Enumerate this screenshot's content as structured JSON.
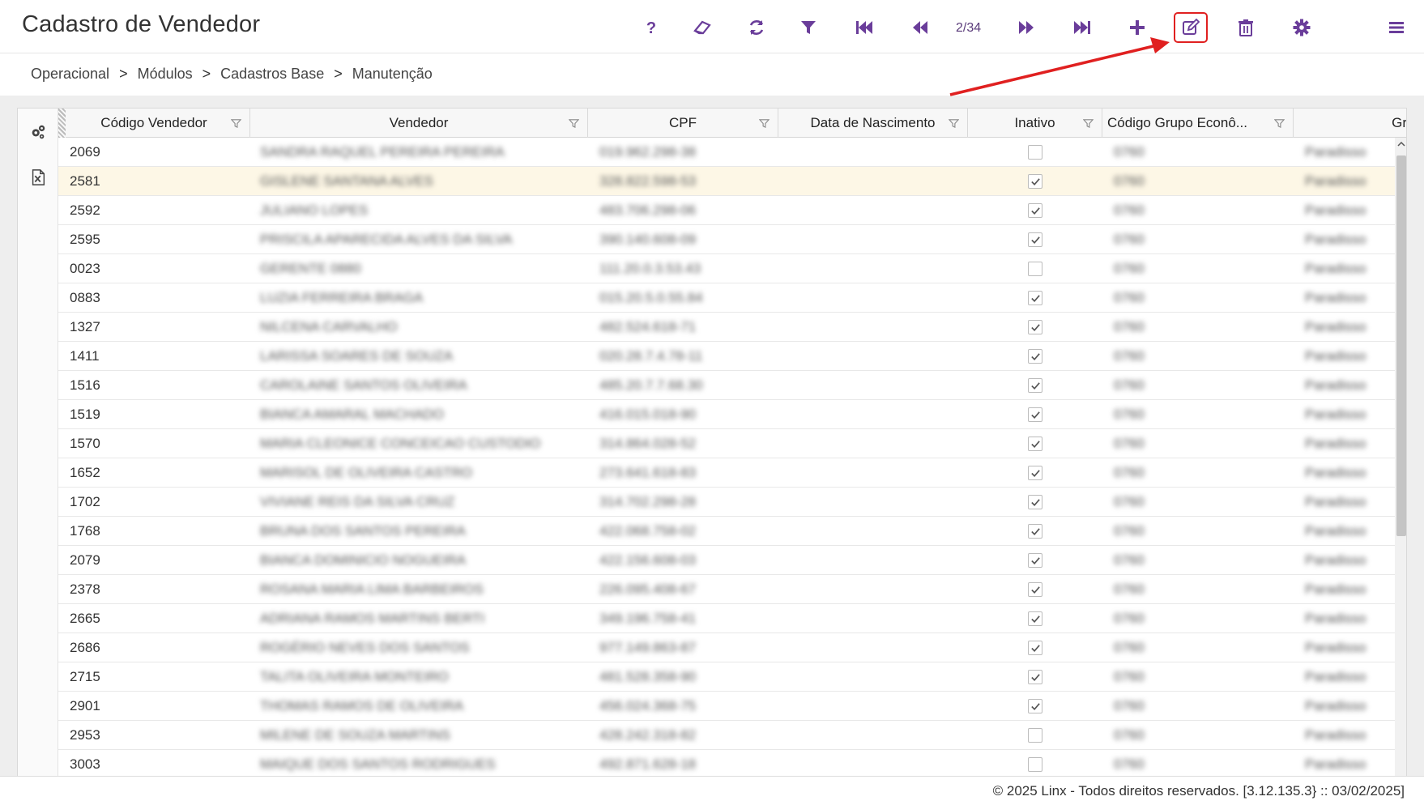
{
  "app": {
    "title": "Cadastro de Vendedor",
    "pager": "2/34",
    "accent_color": "#6a3d9a",
    "highlight_color": "#e02020"
  },
  "toolbar": {
    "items": [
      {
        "name": "help",
        "icon": "question-icon"
      },
      {
        "name": "clear",
        "icon": "eraser-icon"
      },
      {
        "name": "refresh",
        "icon": "refresh-icon"
      },
      {
        "name": "filter",
        "icon": "filter-icon"
      },
      {
        "name": "first",
        "icon": "first-page-icon"
      },
      {
        "name": "previous",
        "icon": "previous-page-icon"
      },
      {
        "name": "next",
        "icon": "next-page-icon"
      },
      {
        "name": "last",
        "icon": "last-page-icon"
      },
      {
        "name": "add",
        "icon": "plus-icon"
      },
      {
        "name": "edit",
        "icon": "edit-icon"
      },
      {
        "name": "delete",
        "icon": "trash-icon"
      },
      {
        "name": "settings",
        "icon": "gear-icon"
      },
      {
        "name": "menu",
        "icon": "hamburger-menu-icon"
      }
    ]
  },
  "breadcrumb": [
    "Operacional",
    "Módulos",
    "Cadastros Base",
    "Manutenção"
  ],
  "breadcrumb_separator": ">",
  "grid": {
    "columns": [
      {
        "label": "Código Vendedor"
      },
      {
        "label": "Vendedor"
      },
      {
        "label": "CPF"
      },
      {
        "label": "Data de Nascimento"
      },
      {
        "label": "Inativo"
      },
      {
        "label": "Código Grupo Econô..."
      },
      {
        "label": "Gr"
      }
    ],
    "rows": [
      {
        "code": "2069",
        "name": "SANDRA RAQUEL PEREIRA PEREIRA",
        "cpf": "019.962.298-38",
        "birth": "",
        "inativo": false,
        "grupo": "0760",
        "grupo_nome": "Paradisso"
      },
      {
        "code": "2581",
        "name": "GISLENE SANTANA ALVES",
        "cpf": "328.822.598-53",
        "birth": "",
        "inativo": true,
        "grupo": "0760",
        "grupo_nome": "Paradisso"
      },
      {
        "code": "2592",
        "name": "JULIANO LOPES",
        "cpf": "483.706.298-06",
        "birth": "",
        "inativo": true,
        "grupo": "0760",
        "grupo_nome": "Paradisso"
      },
      {
        "code": "2595",
        "name": "PRISCILA APARECIDA ALVES DA SILVA",
        "cpf": "390.140.608-09",
        "birth": "",
        "inativo": true,
        "grupo": "0760",
        "grupo_nome": "Paradisso"
      },
      {
        "code": "0023",
        "name": "GERENTE 0880",
        "cpf": "111.20.0.3.53.43",
        "birth": "",
        "inativo": false,
        "grupo": "0760",
        "grupo_nome": "Paradisso"
      },
      {
        "code": "0883",
        "name": "LUZIA FERREIRA BRAGA",
        "cpf": "015.20.5.0.55.84",
        "birth": "",
        "inativo": true,
        "grupo": "0760",
        "grupo_nome": "Paradisso"
      },
      {
        "code": "1327",
        "name": "NILCENA CARVALHO",
        "cpf": "482.524.618-71",
        "birth": "",
        "inativo": true,
        "grupo": "0760",
        "grupo_nome": "Paradisso"
      },
      {
        "code": "1411",
        "name": "LARISSA SOARES DE SOUZA",
        "cpf": "020.28.7.4.78-11",
        "birth": "",
        "inativo": true,
        "grupo": "0760",
        "grupo_nome": "Paradisso"
      },
      {
        "code": "1516",
        "name": "CAROLAINE SANTOS OLIVEIRA",
        "cpf": "485.20.7.7.68.30",
        "birth": "",
        "inativo": true,
        "grupo": "0760",
        "grupo_nome": "Paradisso"
      },
      {
        "code": "1519",
        "name": "BIANCA AMARAL MACHADO",
        "cpf": "416.015.018-90",
        "birth": "",
        "inativo": true,
        "grupo": "0760",
        "grupo_nome": "Paradisso"
      },
      {
        "code": "1570",
        "name": "MARIA CLEONICE CONCEICAO CUSTODIO",
        "cpf": "314.864.028-52",
        "birth": "",
        "inativo": true,
        "grupo": "0760",
        "grupo_nome": "Paradisso"
      },
      {
        "code": "1652",
        "name": "MARISOL DE OLIVEIRA CASTRO",
        "cpf": "273.641.618-83",
        "birth": "",
        "inativo": true,
        "grupo": "0760",
        "grupo_nome": "Paradisso"
      },
      {
        "code": "1702",
        "name": "VIVIANE REIS DA SILVA CRUZ",
        "cpf": "314.702.298-28",
        "birth": "",
        "inativo": true,
        "grupo": "0760",
        "grupo_nome": "Paradisso"
      },
      {
        "code": "1768",
        "name": "BRUNA DOS SANTOS PEREIRA",
        "cpf": "422.068.758-02",
        "birth": "",
        "inativo": true,
        "grupo": "0760",
        "grupo_nome": "Paradisso"
      },
      {
        "code": "2079",
        "name": "BIANCA DOMINICIO NOGUEIRA",
        "cpf": "422.156.608-03",
        "birth": "",
        "inativo": true,
        "grupo": "0760",
        "grupo_nome": "Paradisso"
      },
      {
        "code": "2378",
        "name": "ROSANA MARIA LIMA BARBEIROS",
        "cpf": "226.095.408-67",
        "birth": "",
        "inativo": true,
        "grupo": "0760",
        "grupo_nome": "Paradisso"
      },
      {
        "code": "2665",
        "name": "ADRIANA RAMOS MARTINS BERTI",
        "cpf": "349.196.758-41",
        "birth": "",
        "inativo": true,
        "grupo": "0760",
        "grupo_nome": "Paradisso"
      },
      {
        "code": "2686",
        "name": "ROGÉRIO NEVES DOS SANTOS",
        "cpf": "977.149.863-87",
        "birth": "",
        "inativo": true,
        "grupo": "0760",
        "grupo_nome": "Paradisso"
      },
      {
        "code": "2715",
        "name": "TALITA OLIVEIRA MONTEIRO",
        "cpf": "481.528.358-90",
        "birth": "",
        "inativo": true,
        "grupo": "0760",
        "grupo_nome": "Paradisso"
      },
      {
        "code": "2901",
        "name": "THOMAS RAMOS DE OLIVEIRA",
        "cpf": "456.024.368-75",
        "birth": "",
        "inativo": true,
        "grupo": "0760",
        "grupo_nome": "Paradisso"
      },
      {
        "code": "2953",
        "name": "MILENE DE SOUZA MARTINS",
        "cpf": "428.242.318-82",
        "birth": "",
        "inativo": false,
        "grupo": "0760",
        "grupo_nome": "Paradisso"
      },
      {
        "code": "3003",
        "name": "MAIQUE DOS SANTOS RODRIGUES",
        "cpf": "492.871.628-18",
        "birth": "",
        "inativo": false,
        "grupo": "0760",
        "grupo_nome": "Paradisso"
      }
    ],
    "selected_row": 1
  },
  "footer": {
    "text": "© 2025 Linx - Todos direitos reservados. [3.12.135.3} :: 03/02/2025]"
  }
}
